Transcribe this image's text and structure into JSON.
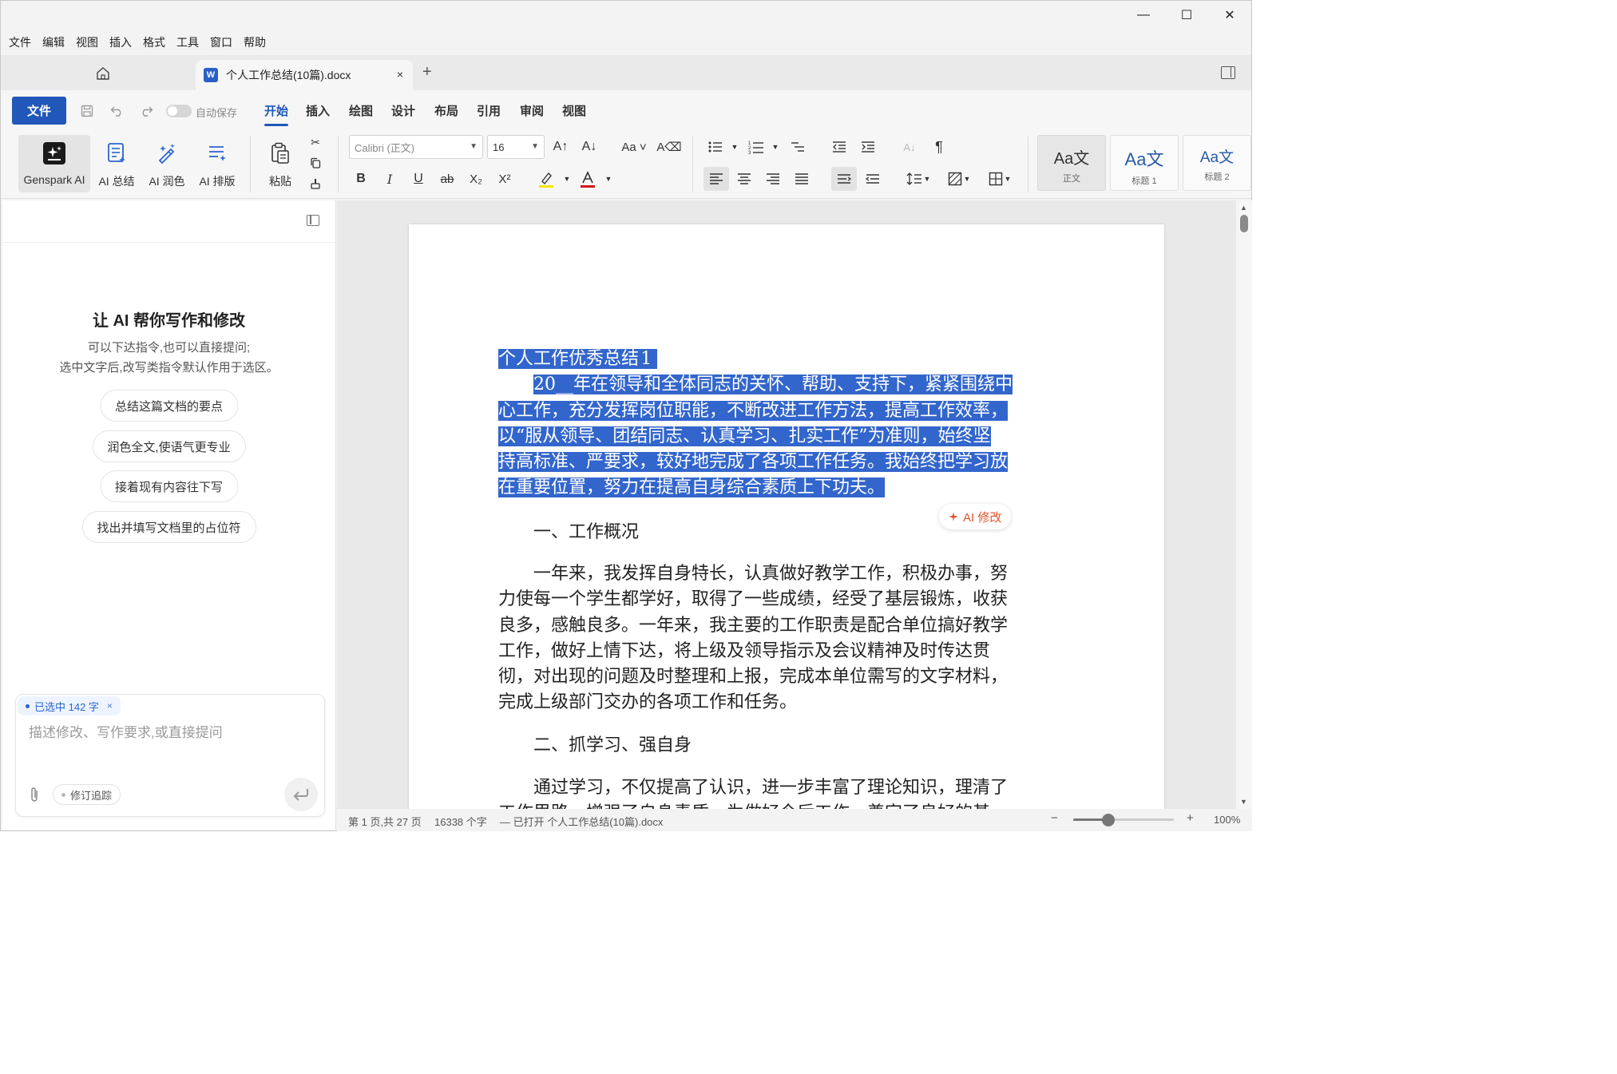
{
  "window": {
    "minimize": "—",
    "maximize": "☐",
    "close": "✕"
  },
  "menubar": [
    "文件",
    "编辑",
    "视图",
    "插入",
    "格式",
    "工具",
    "窗口",
    "帮助"
  ],
  "tab": {
    "icon_letter": "W",
    "title": "个人工作总结(10篇).docx",
    "close": "×",
    "new_tab": "+"
  },
  "ribbon": {
    "file_button": "文件",
    "autosave_label": "自动保存",
    "autosave_on": false,
    "tabs": [
      "开始",
      "插入",
      "绘图",
      "设计",
      "布局",
      "引用",
      "审阅",
      "视图"
    ],
    "active_tab": "开始"
  },
  "toolbar": {
    "ai_buttons": [
      "Genspark AI",
      "AI 总结",
      "AI 润色",
      "AI 排版"
    ],
    "paste_label": "粘贴",
    "font_name": "Calibri (正文)",
    "font_size": "16",
    "styles": [
      {
        "sample": "Aa文",
        "name": "正文"
      },
      {
        "sample": "Aa文",
        "name": "标题 1"
      },
      {
        "sample": "Aa文",
        "name": "标题 2"
      }
    ],
    "highlight_color": "#f2e600",
    "font_color": "#d11a1a"
  },
  "ai_panel": {
    "title": "让 AI 帮你写作和修改",
    "subtitle_line1": "可以下达指令,也可以直接提问;",
    "subtitle_line2": "选中文字后,改写类指令默认作用于选区。",
    "suggestions": [
      "总结这篇文档的要点",
      "润色全文,使语气更专业",
      "接着现有内容往下写",
      "找出并填写文档里的占位符"
    ],
    "selection_badge": "已选中 142 字",
    "selection_close": "×",
    "prompt_placeholder": "描述修改、写作要求,或直接提问",
    "revision_label": "修订追踪"
  },
  "document": {
    "selected_title": "个人工作优秀总结",
    "selected_title_num": "1",
    "para1_lines": [
      "20__年在领导和全体同志的关怀、帮助、支持下，紧紧围绕中",
      "心工作，充分发挥岗位职能，不断改进工作方法，提高工作效率，",
      "以“服从领导、团结同志、认真学习、扎实工作”为准则，始终坚",
      "持高标准、严要求，较好地完成了各项工作任务。我始终把学习放",
      "在重要位置，努力在提高自身综合素质上下功夫。"
    ],
    "heading1": "一、工作概况",
    "para2_lines": [
      "一年来，我发挥自身特长，认真做好教学工作，积极办事，努",
      "力使每一个学生都学好，取得了一些成绩，经受了基层锻炼，收获",
      "良多，感触良多。一年来，我主要的工作职责是配合单位搞好教学",
      "工作，做好上情下达，将上级及领导指示及会议精神及时传达贯",
      "彻，对出现的问题及时整理和上报，完成本单位需写的文字材料，",
      "完成上级部门交办的各项工作和任务。"
    ],
    "heading2": "二、抓学习、强自身",
    "para3_lines": [
      "通过学习，不仅提高了认识，进一步丰富了理论知识，理清了",
      "工作思路，增强了自身素质，为做好今后工作，奠定了良好的基"
    ],
    "ai_fix_label": "AI 修改",
    "selection_color": "#3366cc"
  },
  "statusbar": {
    "page_info": "第 1 页,共 27 页",
    "word_count": "16338 个字",
    "opened": "— 已打开 个人工作总结(10篇).docx",
    "zoom_minus": "−",
    "zoom_plus": "+",
    "zoom_level": "100%",
    "zoom_fraction": 0.35
  }
}
